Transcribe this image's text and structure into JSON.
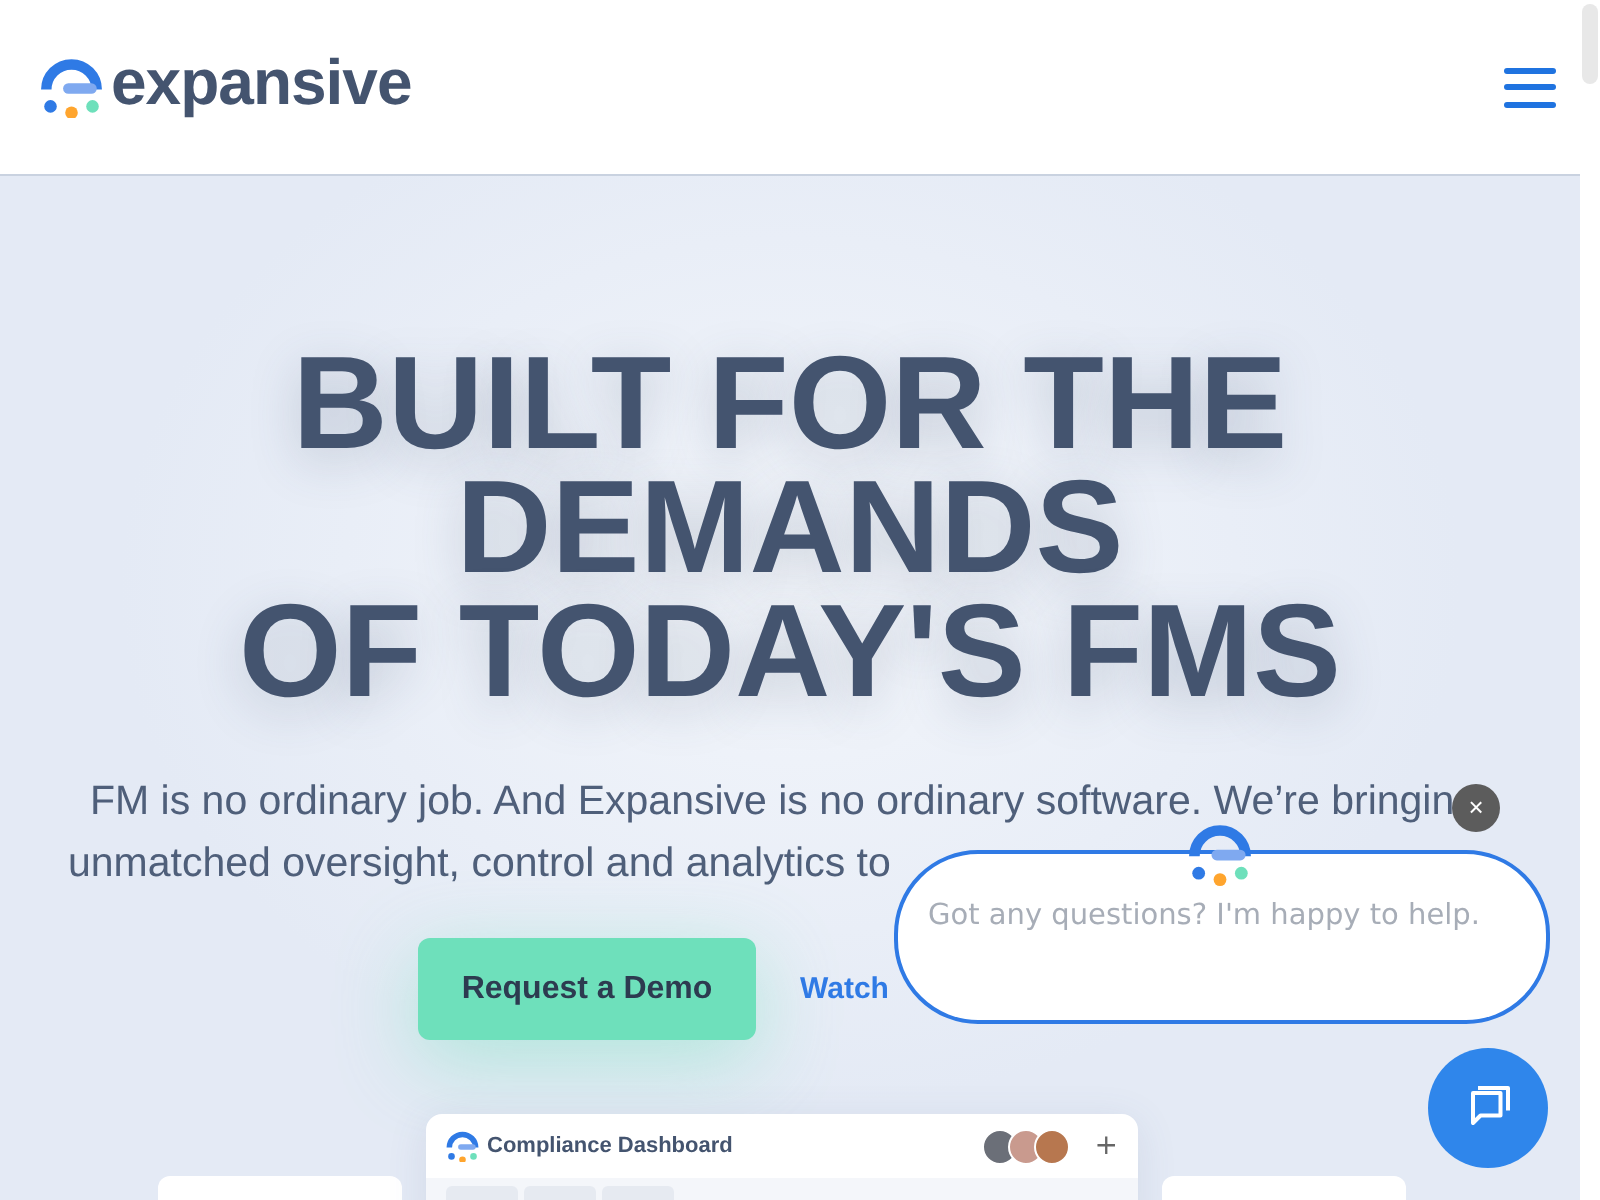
{
  "header": {
    "brand": "expansive"
  },
  "hero": {
    "heading_lines": [
      "BUILT FOR THE",
      "DEMANDS",
      "OF TODAY'S FMS"
    ],
    "intro_lines": [
      "FM is no ordinary job. And Expansive is no ordinary software. We’re bringin",
      "unmatched oversight, control and analytics to"
    ],
    "buttons": [
      {
        "label": "Request a Demo",
        "kind": "primary"
      },
      {
        "label": "Watch",
        "kind": "link"
      }
    ]
  },
  "dashboard": {
    "title": "Compliance Dashboard",
    "add": "+"
  },
  "chat": {
    "message": "Got any questions? I'm happy to help.",
    "close": "×"
  }
}
